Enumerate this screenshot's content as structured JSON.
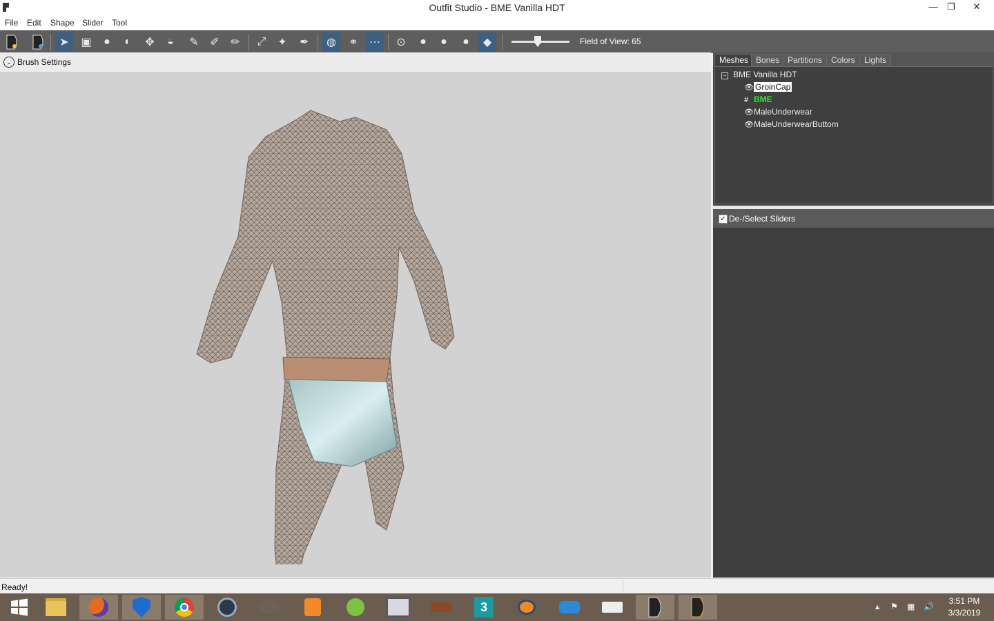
{
  "window": {
    "title": "Outfit Studio - BME Vanilla HDT"
  },
  "menu": [
    "File",
    "Edit",
    "Shape",
    "Slider",
    "Tool"
  ],
  "toolbar": {
    "icons": [
      "outfit-file-icon",
      "outfit-ref-icon",
      "select-brush-icon",
      "mask-rect-icon",
      "inflate-brush-icon",
      "deflate-brush-icon",
      "move-brush-icon",
      "smooth-brush-icon",
      "undiff-brush-icon",
      "weight-brush-icon",
      "color-brush-icon",
      "transform-icon",
      "pivot-icon",
      "collision-icon",
      "mirror-x-icon",
      "connected-icon",
      "mirror-icon",
      "brush-small-icon",
      "brush-med-icon",
      "brush-large-icon",
      "brush-xl-icon",
      "cube-icon"
    ],
    "fov_label": "Field of View: 65",
    "fov_value": 65
  },
  "brush": {
    "label": "Brush Settings"
  },
  "panel": {
    "tabs": [
      "Meshes",
      "Bones",
      "Partitions",
      "Colors",
      "Lights"
    ],
    "active_tab": "Meshes",
    "root": "BME Vanilla HDT",
    "meshes": [
      "GroinCap",
      "BME",
      "MaleUnderwear",
      "MaleUnderwearButtom"
    ],
    "slider_header": "De-/Select Sliders"
  },
  "status": {
    "text": "Ready!"
  },
  "taskbar": {
    "apps": [
      "start-icon",
      "explorer-icon",
      "firefox-icon",
      "defender-icon",
      "chrome-icon",
      "camera-icon",
      "gimp-icon",
      "media-icon",
      "android-studio-icon",
      "monitor-icon",
      "anvil-icon",
      "3dsmax-icon",
      "blender-icon",
      "link-icon",
      "nifskope-icon",
      "outfit-studio-icon",
      "outfit-studio-2-icon"
    ],
    "time": "3:51 PM",
    "date": "3/3/2019"
  },
  "colors": {
    "accent": "#3c5f82",
    "bme_mesh": "#35e335"
  }
}
